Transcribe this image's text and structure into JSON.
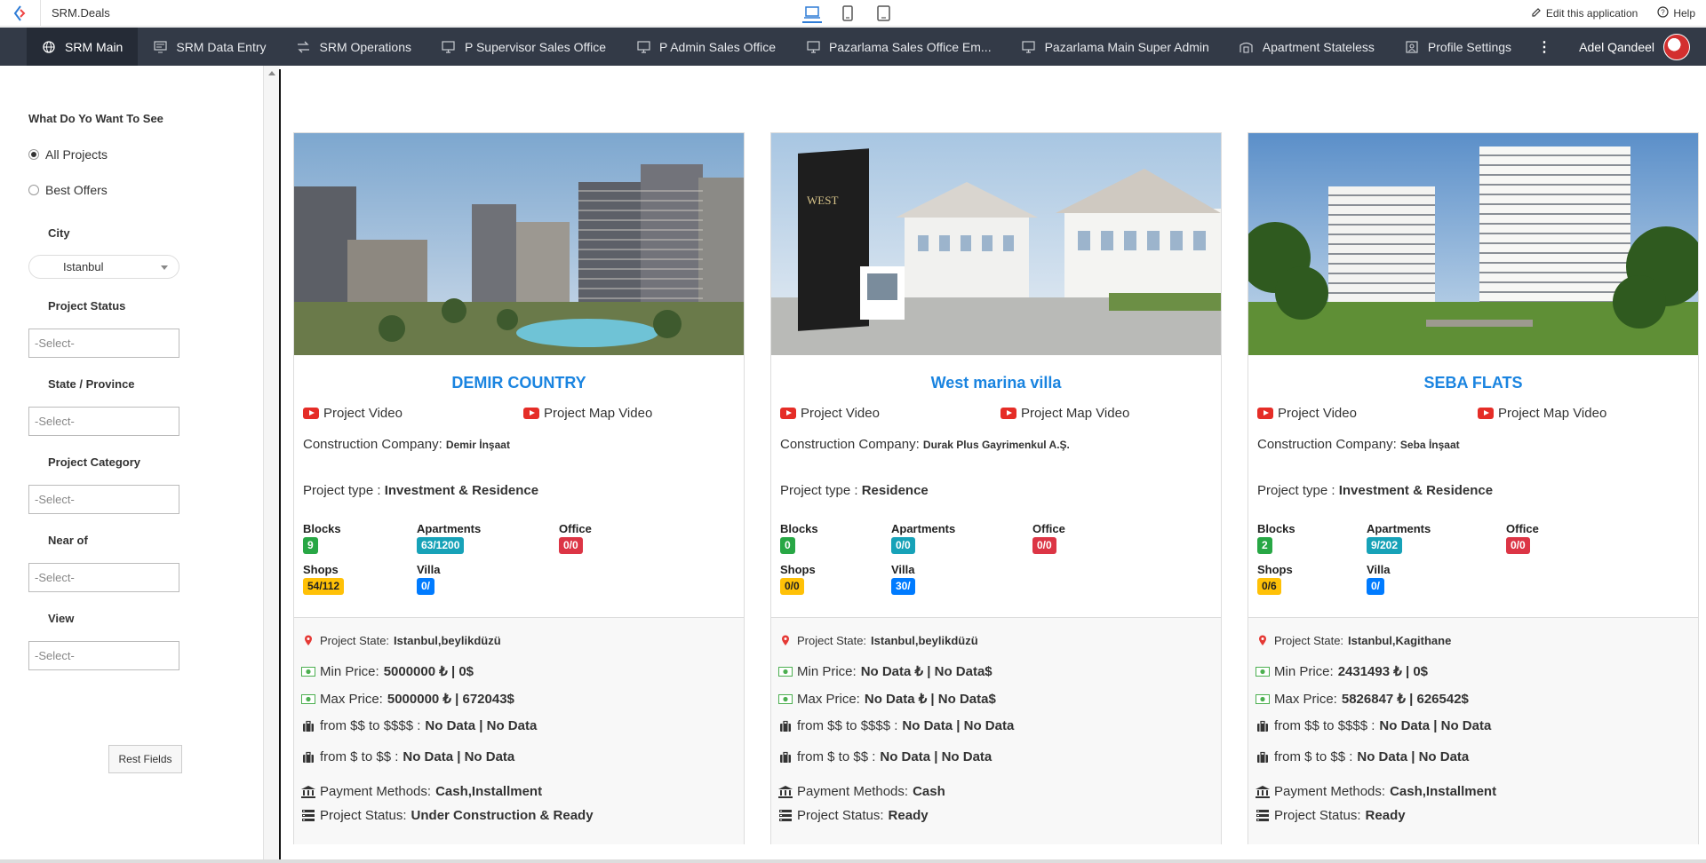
{
  "app": {
    "name": "SRM.Deals",
    "edit_label": "Edit this application",
    "help_label": "Help"
  },
  "nav": {
    "items": [
      {
        "label": "SRM Main",
        "icon": "globe-icon"
      },
      {
        "label": "SRM Data Entry",
        "icon": "form-icon"
      },
      {
        "label": "SRM Operations",
        "icon": "arrows-icon"
      },
      {
        "label": "P Supervisor Sales Office",
        "icon": "monitor-icon"
      },
      {
        "label": "P Admin Sales Office",
        "icon": "monitor-icon"
      },
      {
        "label": "Pazarlama Sales Office Em...",
        "icon": "monitor-icon"
      },
      {
        "label": "Pazarlama Main Super Admin",
        "icon": "monitor-icon"
      },
      {
        "label": "Apartment Stateless",
        "icon": "building-icon"
      },
      {
        "label": "Profile Settings",
        "icon": "profile-icon"
      }
    ],
    "user_name": "Adel Qandeel"
  },
  "sidebar": {
    "heading": "What Do Yo Want To See",
    "radio_all": "All Projects",
    "radio_best": "Best Offers",
    "city_label": "City",
    "city_value": "Istanbul",
    "status_label": "Project Status",
    "state_label": "State / Province",
    "category_label": "Project Category",
    "near_label": "Near of",
    "view_label": "View",
    "select_placeholder": "-Select-",
    "reset_label": "Rest Fields"
  },
  "card_labels": {
    "project_video": "Project Video",
    "project_map_video": "Project Map Video",
    "construction_company": "Construction Company:",
    "project_type": "Project type :",
    "blocks": "Blocks",
    "apartments": "Apartments",
    "office": "Office",
    "shops": "Shops",
    "villa": "Villa",
    "project_state": "Project State:",
    "min_price": "Min Price:",
    "max_price": "Max Price:",
    "range_high": "from $$ to $$$$ :",
    "range_low": "from $ to $$ :",
    "payment_methods": "Payment Methods:",
    "project_status": "Project Status:"
  },
  "projects": [
    {
      "title": "DEMIR COUNTRY",
      "company": "Demir İnşaat",
      "type": "Investment & Residence",
      "blocks": "9",
      "apartments": "63/1200",
      "office": "0/0",
      "shops": "54/112",
      "villa": "0/",
      "state": "Istanbul,beylikdüzü",
      "min_price": "5000000 ₺ | 0$",
      "max_price": "5000000 ₺ | 672043$",
      "range_high": "No Data | No Data",
      "range_low": "No Data | No Data",
      "payment": "Cash,Installment",
      "status": "Under Construction & Ready"
    },
    {
      "title": "West marina villa",
      "company": "Durak Plus Gayrimenkul A.Ş.",
      "type": "Residence",
      "blocks": "0",
      "apartments": "0/0",
      "office": "0/0",
      "shops": "0/0",
      "villa": "30/",
      "state": "Istanbul,beylikdüzü",
      "min_price": "No Data ₺ | No Data$",
      "max_price": "No Data ₺ | No Data$",
      "range_high": "No Data | No Data",
      "range_low": "No Data | No Data",
      "payment": "Cash",
      "status": "Ready"
    },
    {
      "title": "SEBA FLATS",
      "company": "Seba İnşaat",
      "type": "Investment & Residence",
      "blocks": "2",
      "apartments": "9/202",
      "office": "0/0",
      "shops": "0/6",
      "villa": "0/",
      "state": "Istanbul,Kagithane",
      "min_price": "2431493 ₺ | 0$",
      "max_price": "5826847 ₺ | 626542$",
      "range_high": "No Data | No Data",
      "range_low": "No Data | No Data",
      "payment": "Cash,Installment",
      "status": "Ready"
    }
  ]
}
